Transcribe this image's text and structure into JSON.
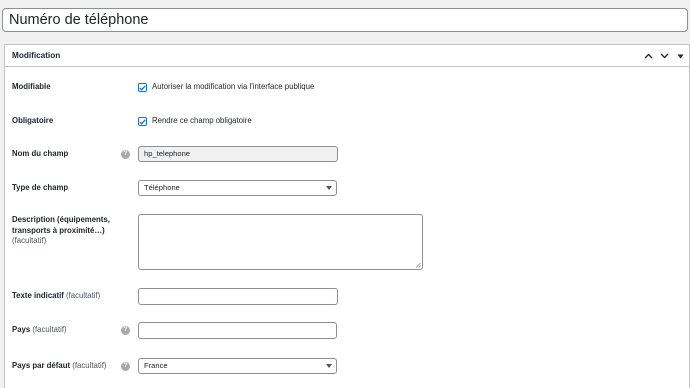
{
  "title_input": {
    "value": "Numéro de téléphone"
  },
  "panel": {
    "title": "Modification",
    "controls": [
      "chevron-up-icon",
      "chevron-down-icon",
      "caret-down-icon"
    ]
  },
  "fields": {
    "modifiable": {
      "label": "Modifiable",
      "checkbox_label": "Autoriser la modification via l'interface publique",
      "checked": true
    },
    "obligatoire": {
      "label": "Obligatoire",
      "checkbox_label": "Rendre ce champ obligatoire",
      "checked": true
    },
    "nom_du_champ": {
      "label": "Nom du champ",
      "value": "hp_telephone"
    },
    "type_de_champ": {
      "label": "Type de champ",
      "value": "Téléphone"
    },
    "description": {
      "label_line1": "Description (équipements,",
      "label_line2": "transports à proximité…)",
      "optional": "(facultatif)",
      "value": ""
    },
    "texte_indicatif": {
      "label": "Texte indicatif",
      "optional": "(facultatif)",
      "value": ""
    },
    "pays": {
      "label": "Pays",
      "optional": "(facultatif)",
      "value": ""
    },
    "pays_par_defaut": {
      "label": "Pays par défaut",
      "optional": "(facultatif)",
      "value": "France"
    }
  },
  "colors": {
    "accent": "#2271b1",
    "border": "#c3c4c7",
    "background": "#f0f0f1"
  }
}
